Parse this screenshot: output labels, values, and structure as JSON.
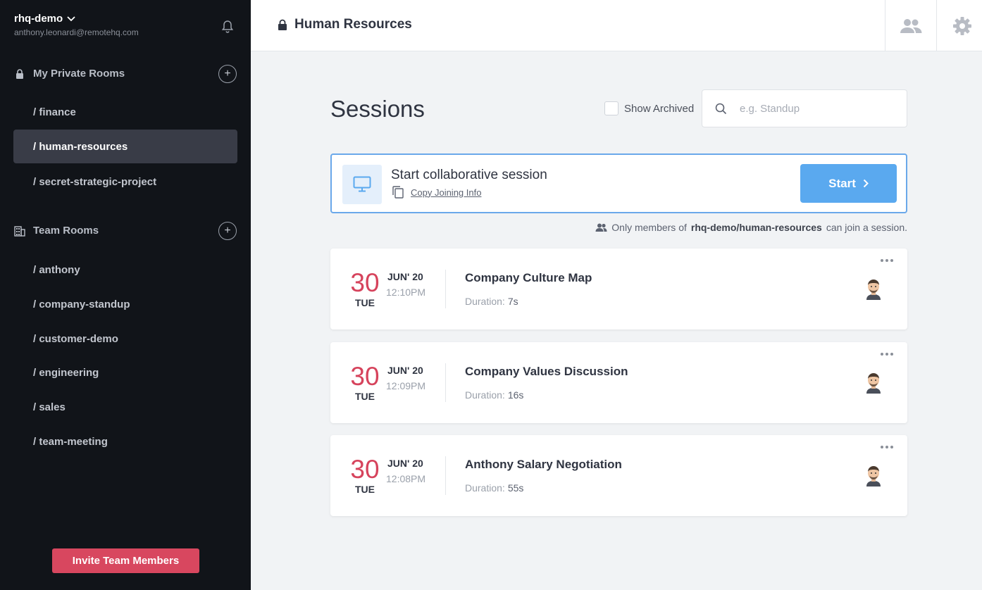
{
  "sidebar": {
    "workspace": "rhq-demo",
    "email": "anthony.leonardi@remotehq.com",
    "private_section": "My Private Rooms",
    "private_rooms": [
      {
        "label": "/ finance"
      },
      {
        "label": "/ human-resources",
        "active": true
      },
      {
        "label": "/ secret-strategic-project"
      }
    ],
    "team_section": "Team Rooms",
    "team_rooms": [
      {
        "label": "/ anthony"
      },
      {
        "label": "/ company-standup"
      },
      {
        "label": "/ customer-demo"
      },
      {
        "label": "/ engineering"
      },
      {
        "label": "/ sales"
      },
      {
        "label": "/ team-meeting"
      }
    ],
    "invite_label": "Invite Team Members"
  },
  "header": {
    "title": "Human Resources"
  },
  "main": {
    "title": "Sessions",
    "show_archived": "Show Archived",
    "search_placeholder": "e.g. Standup",
    "start_card": {
      "title": "Start collaborative session",
      "copy_link": "Copy Joining Info",
      "button": "Start"
    },
    "notice": {
      "prefix": "Only members of",
      "room": "rhq-demo/human-resources",
      "suffix": "can join a session."
    },
    "sessions": [
      {
        "day": "30",
        "dow": "TUE",
        "month": "JUN' 20",
        "time": "12:10PM",
        "title": "Company Culture Map",
        "duration_label": "Duration:",
        "duration": "7s"
      },
      {
        "day": "30",
        "dow": "TUE",
        "month": "JUN' 20",
        "time": "12:09PM",
        "title": "Company Values Discussion",
        "duration_label": "Duration:",
        "duration": "16s"
      },
      {
        "day": "30",
        "dow": "TUE",
        "month": "JUN' 20",
        "time": "12:08PM",
        "title": "Anthony Salary Negotiation",
        "duration_label": "Duration:",
        "duration": "55s"
      }
    ]
  },
  "colors": {
    "accent": "#5aa9ef",
    "danger": "#d8475f",
    "sidebar_bg": "#111419"
  }
}
